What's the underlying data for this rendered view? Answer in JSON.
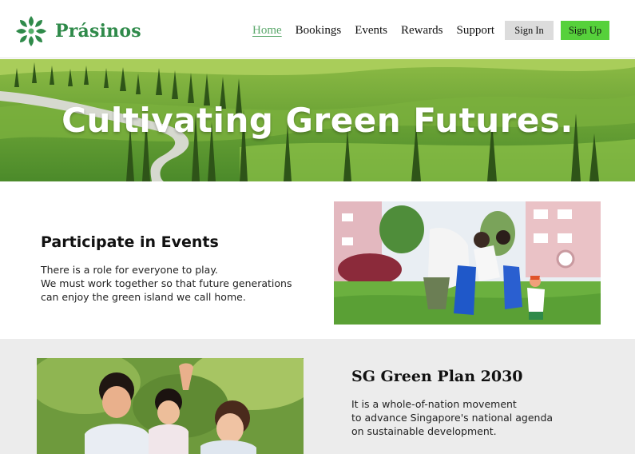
{
  "brand": {
    "name": "Prásinos",
    "logo_icon": "leaf-cluster-icon",
    "color": "#2f8a4a"
  },
  "nav": {
    "links": [
      {
        "label": "Home",
        "active": true
      },
      {
        "label": "Bookings",
        "active": false
      },
      {
        "label": "Events",
        "active": false
      },
      {
        "label": "Rewards",
        "active": false
      },
      {
        "label": "Support",
        "active": false
      }
    ],
    "signin_label": "Sign In",
    "signup_label": "Sign Up",
    "active_color": "#5aa86b",
    "signup_color": "#56d13b"
  },
  "hero": {
    "title": "Cultivating Green Futures."
  },
  "events": {
    "title": "Participate in Events",
    "lines": [
      "There is a role for everyone to play.",
      "We must work together so that future generations",
      "can enjoy the green island we call home."
    ]
  },
  "green_plan": {
    "title": "SG Green Plan 2030",
    "lines": [
      "It is a whole-of-nation movement",
      "to advance Singapore's national agenda",
      "on sustainable development."
    ]
  }
}
